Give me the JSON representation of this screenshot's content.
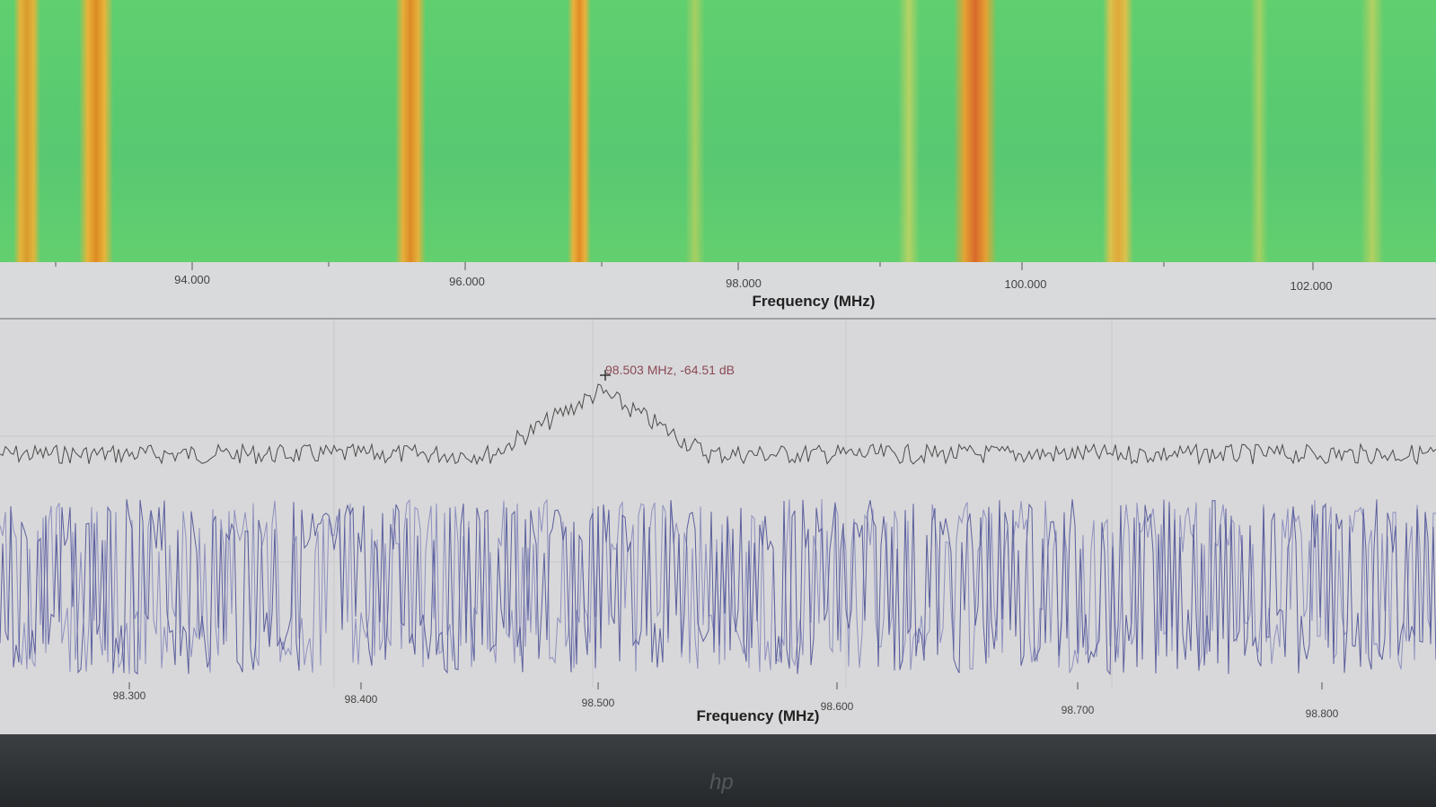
{
  "waterfall_axis": {
    "tick_labels": [
      "94.000",
      "96.000",
      "98.000",
      "100.000",
      "102.000"
    ],
    "title": "Frequency (MHz)"
  },
  "spectrum_axis": {
    "tick_labels": [
      "98.300",
      "98.400",
      "98.500",
      "98.600",
      "98.700",
      "98.800"
    ],
    "title": "Frequency (MHz)"
  },
  "marker": {
    "readout": "98.503 MHz, -64.51 dB"
  },
  "colors": {
    "waterfall_background": "#5fcf6f",
    "signal_band": "#e0a334",
    "trace_dark": "#4a4a4a",
    "trace_blue": "#5b5f9c",
    "readout": "#8b4a55"
  },
  "icons": {
    "marker": "crosshair-icon",
    "logo": "hp-logo"
  }
}
